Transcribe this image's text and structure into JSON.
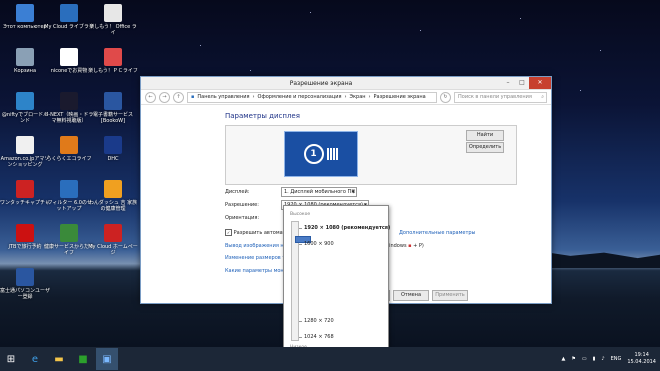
{
  "desktop": {
    "icons": [
      {
        "label": "Этот компьютер",
        "icon": "computer-icon",
        "color": "#3b7fd4"
      },
      {
        "label": "My Cloud ライブラリ",
        "icon": "cloud-icon",
        "color": "#2a6ebd"
      },
      {
        "label": "楽しもう！ Office ライ",
        "icon": "office-icon",
        "color": "#e7e7e7"
      },
      {
        "label": "Корзина",
        "icon": "recycle-bin-icon",
        "color": "#8aa0b5"
      },
      {
        "label": "niconeでお買物",
        "icon": "shopping-icon",
        "color": "#ffffff"
      },
      {
        "label": "楽しもう！ＰＣライフ",
        "icon": "pc-life-icon",
        "color": "#e04a4a"
      },
      {
        "label": "@niftyでブロードバンド",
        "icon": "nifty-icon",
        "color": "#2d84c9"
      },
      {
        "label": "U-NEXT（映画・ドラマ無料視聴版）",
        "icon": "unext-icon",
        "color": "#1a1a2e"
      },
      {
        "label": "電子書籍サービス [BookoW]",
        "icon": "book-icon",
        "color": "#2a56a0"
      },
      {
        "label": "Amazon.co.jpアマゾンショッピング",
        "icon": "amazon-icon",
        "color": "#f0f0f0"
      },
      {
        "label": "らくらくエコライフ",
        "icon": "eco-life-icon",
        "color": "#e07a1a"
      },
      {
        "label": "DHC",
        "icon": "dhc-icon",
        "color": "#1a3a8a"
      },
      {
        "label": "ワンタッチキャプチャ",
        "icon": "capture-icon",
        "color": "#cc2222"
      },
      {
        "label": "iフィルター 6.0のセットアップ",
        "icon": "filter-icon",
        "color": "#2a6ebd"
      },
      {
        "label": "わんダッシュ 吉 家族の健康管理",
        "icon": "health-icon",
        "color": "#f0a020"
      },
      {
        "label": "JTBで旅行予約",
        "icon": "jtb-icon",
        "color": "#cc1111"
      },
      {
        "label": "健康サービスからだライフ",
        "icon": "health-service-icon",
        "color": "#3a8a3a"
      },
      {
        "label": "My Cloud ホームページ",
        "icon": "cloud-home-icon",
        "color": "#cc2222"
      },
      {
        "label": "富士通パソコンユーザー登録",
        "icon": "fujitsu-icon",
        "color": "#2a56a0"
      }
    ]
  },
  "window": {
    "title": "Разрешение экрана",
    "breadcrumb": [
      "Панель управления",
      "Оформление и персонализация",
      "Экран",
      "Разрешение экрана"
    ],
    "search_placeholder": "Поиск в панели управления",
    "heading": "Параметры дисплея",
    "monitor_number": "1",
    "find_button": "Найти",
    "identify_button": "Определить",
    "display_label": "Дисплей:",
    "display_value": "1. Дисплей мобильного ПК",
    "resolution_label": "Разрешение:",
    "resolution_value": "1920 × 1080 (рекомендуется)",
    "orientation_label": "Ориентация:",
    "allow_checkbox_label": "Разрешить автомати",
    "advanced_link": "Дополнительные параметры",
    "link_project": "Вывод изображения на",
    "link_text_size": "Изменение размеров т",
    "link_monitor_params": "Какие параметры мони",
    "windows_hint_text": "(или Windows",
    "windows_hint_suffix": "+ P)",
    "ok_button": "ОК",
    "cancel_button": "Отмена",
    "apply_button": "Применить"
  },
  "resolution_popup": {
    "high_label": "Высокое",
    "low_label": "Низкое",
    "options": [
      "1920 × 1080 (рекомендуется)",
      "1600 × 900",
      "1280 × 720",
      "1024 × 768"
    ],
    "selected": "1920 × 1080 (рекомендуется)"
  },
  "taskbar": {
    "items": [
      "start-icon",
      "internet-explorer-icon",
      "file-explorer-icon",
      "store-icon",
      "control-panel-icon"
    ],
    "language": "ENG",
    "time": "19:14",
    "date": "15.04.2014"
  }
}
